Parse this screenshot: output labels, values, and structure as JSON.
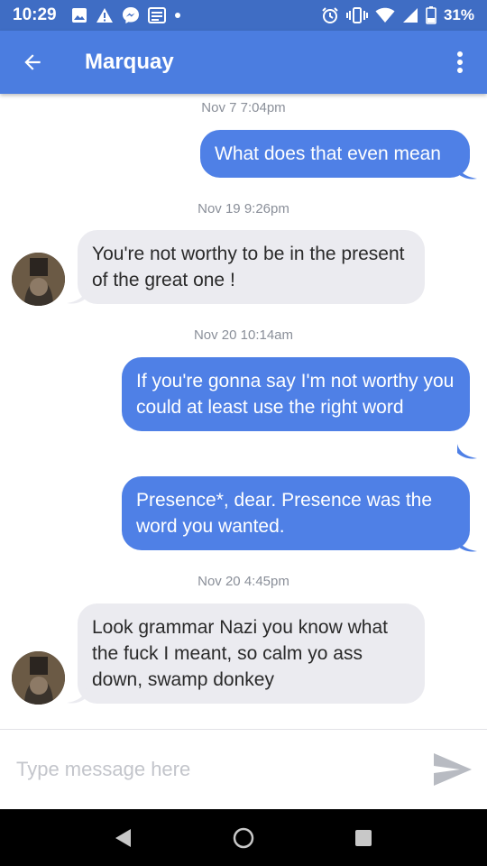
{
  "status_bar": {
    "time": "10:29",
    "battery": "31%",
    "icons": [
      "image-icon",
      "warning-icon",
      "messenger-icon",
      "news-icon",
      "dot-icon",
      "alarm-icon",
      "vibrate-icon",
      "wifi-icon",
      "signal-icon",
      "battery-icon"
    ]
  },
  "app_bar": {
    "title": "Marquay",
    "back_icon": "arrow-back-icon",
    "menu_icon": "more-vert-icon",
    "color": "#4b7de0"
  },
  "messages": [
    {
      "type": "timestamp",
      "text": "Nov 7 7:04pm"
    },
    {
      "type": "outgoing",
      "text": "What does that even mean"
    },
    {
      "type": "timestamp",
      "text": "Nov 19 9:26pm"
    },
    {
      "type": "incoming",
      "text": "You're not worthy to be in the present of the great one !"
    },
    {
      "type": "timestamp",
      "text": "Nov 20 10:14am"
    },
    {
      "type": "outgoing",
      "text": "If you're gonna say I'm not worthy you could at least use the right word"
    },
    {
      "type": "outgoing",
      "text": "Presence*, dear. Presence was the word you wanted."
    },
    {
      "type": "timestamp",
      "text": "Nov 20 4:45pm"
    },
    {
      "type": "incoming",
      "text": "Look grammar Nazi you know what the fuck I meant, so calm yo ass down, swamp donkey"
    }
  ],
  "colors": {
    "outgoing_bubble": "#4f80e6",
    "incoming_bubble": "#ebebf0",
    "timestamp": "#8a8f99"
  },
  "composer": {
    "placeholder": "Type message here",
    "value": "",
    "send_icon": "send-icon"
  },
  "nav_bar": {
    "icons": [
      "nav-back-icon",
      "nav-home-icon",
      "nav-recents-icon"
    ]
  }
}
